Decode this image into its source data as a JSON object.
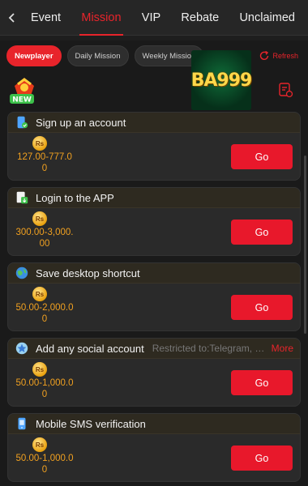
{
  "nav": {
    "tabs": [
      {
        "label": "Event"
      },
      {
        "label": "Mission"
      },
      {
        "label": "VIP"
      },
      {
        "label": "Rebate"
      },
      {
        "label": "Unclaimed"
      }
    ],
    "active_tab": "Mission"
  },
  "filters": {
    "chips": [
      "Newplayer",
      "Daily Mission",
      "Weekly Mission"
    ],
    "active": "Newplayer",
    "refresh_label": "Refresh"
  },
  "badge": {
    "text": "NEW"
  },
  "logo": {
    "text": "BA999"
  },
  "currency_symbol": "Rs",
  "missions": [
    {
      "title": "Sign up an account",
      "note": "",
      "more": "",
      "amount": "127.00-777.00",
      "button": "Go",
      "icon": "phone-check-icon"
    },
    {
      "title": "Login to the APP",
      "note": "",
      "more": "",
      "amount": "300.00-3,000.00",
      "button": "Go",
      "icon": "app-download-icon"
    },
    {
      "title": "Save desktop shortcut",
      "note": "",
      "more": "",
      "amount": "50.00-2,000.00",
      "button": "Go",
      "icon": "globe-icon"
    },
    {
      "title": "Add any social account",
      "note": "Restricted to:Telegram, Fa…",
      "more": "More",
      "amount": "50.00-1,000.00",
      "button": "Go",
      "icon": "social-star-icon"
    },
    {
      "title": "Mobile SMS verification",
      "note": "",
      "more": "",
      "amount": "50.00-1,000.00",
      "button": "Go",
      "icon": "sms-phone-icon"
    }
  ],
  "colors": {
    "accent": "#e8242b",
    "amount": "#f0a020"
  }
}
